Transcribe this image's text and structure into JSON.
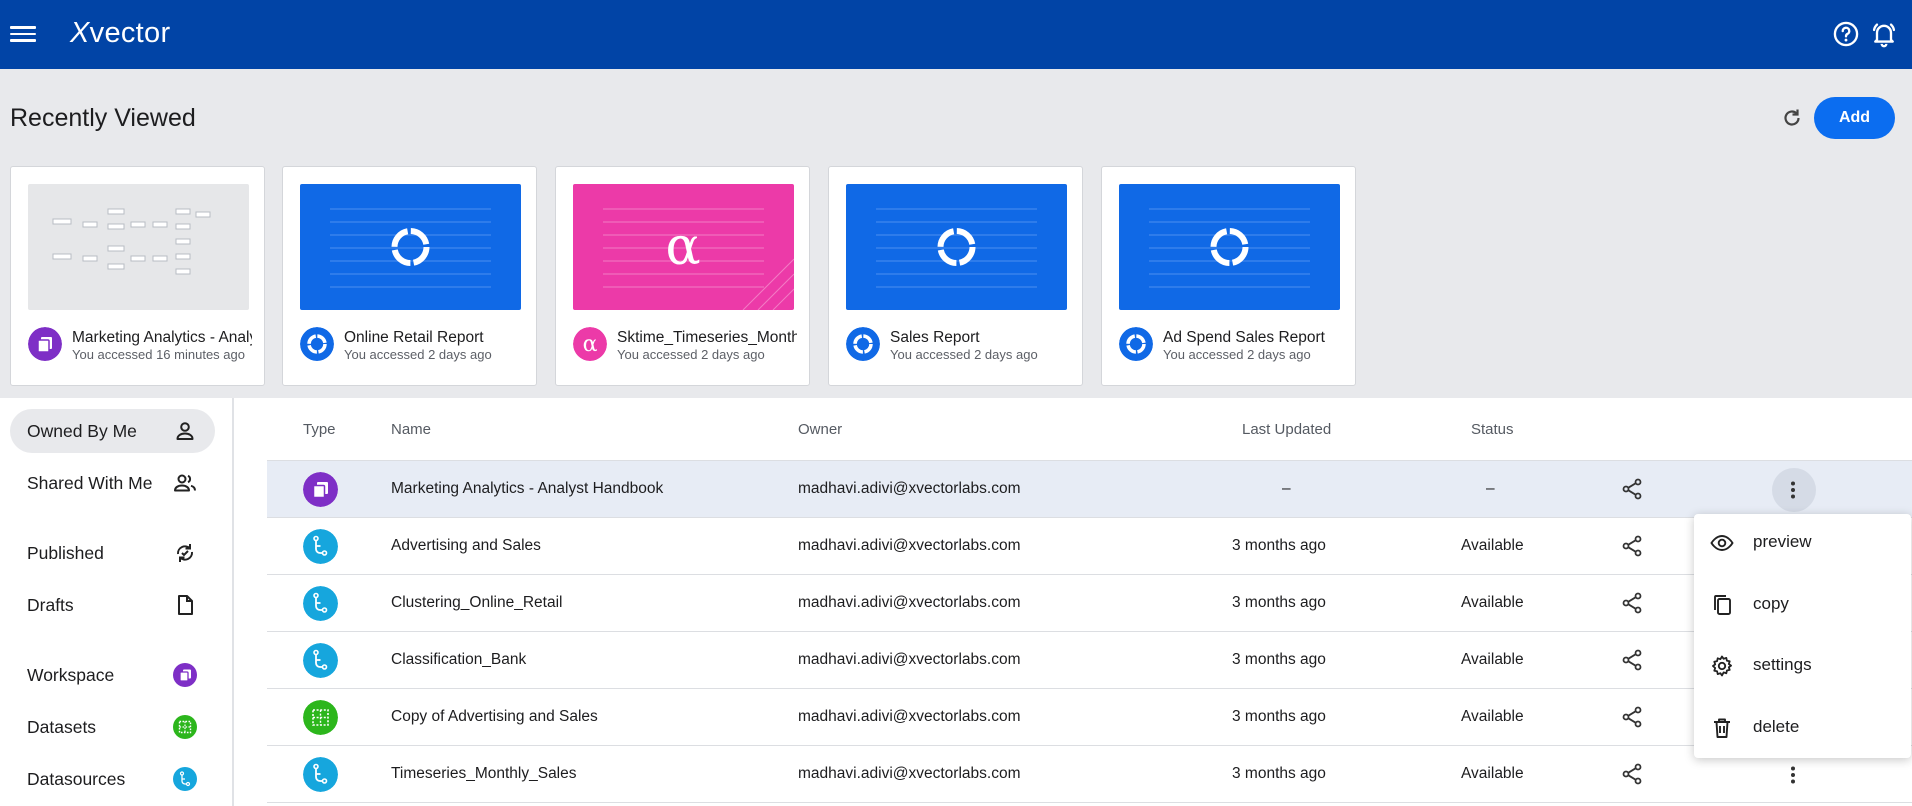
{
  "app": {
    "brand_prefix": "X",
    "brand_rest": "vector"
  },
  "colors": {
    "topbar": "#0144a6",
    "accent": "#0b6df0",
    "workspace": "#7e2fc6",
    "dataset": "#2cb61c",
    "datasource": "#16a6dd",
    "pink": "#ec3aa8"
  },
  "recently_viewed": {
    "title": "Recently Viewed",
    "add_label": "Add",
    "cards": [
      {
        "title": "Marketing Analytics - Analyst Handbook",
        "sub": "You accessed 16 minutes ago",
        "icon": "workspace-icon"
      },
      {
        "title": "Online Retail Report",
        "sub": "You accessed 2 days ago",
        "icon": "report-icon"
      },
      {
        "title": "Sktime_Timeseries_Monthly",
        "sub": "You accessed 2 days ago",
        "icon": "alpha-icon"
      },
      {
        "title": "Sales Report",
        "sub": "You accessed 2 days ago",
        "icon": "report-icon"
      },
      {
        "title": "Ad Spend Sales Report",
        "sub": "You accessed 2 days ago",
        "icon": "report-icon"
      }
    ]
  },
  "sidebar": {
    "items": [
      {
        "label": "Owned By Me",
        "icon": "person-icon"
      },
      {
        "label": "Shared With Me",
        "icon": "people-icon"
      },
      {
        "label": "Published",
        "icon": "sync-icon"
      },
      {
        "label": "Drafts",
        "icon": "file-icon"
      },
      {
        "label": "Workspace",
        "icon": "workspace-icon"
      },
      {
        "label": "Datasets",
        "icon": "dataset-icon"
      },
      {
        "label": "Datasources",
        "icon": "datasource-icon"
      }
    ]
  },
  "table": {
    "headers": {
      "type": "Type",
      "name": "Name",
      "owner": "Owner",
      "updated": "Last Updated",
      "status": "Status"
    },
    "rows": [
      {
        "type": "workspace",
        "name": "Marketing Analytics - Analyst Handbook",
        "owner": "madhavi.adivi@xvectorlabs.com",
        "updated": "–",
        "status": "–"
      },
      {
        "type": "datasource",
        "name": "Advertising and Sales",
        "owner": "madhavi.adivi@xvectorlabs.com",
        "updated": "3 months ago",
        "status": "Available"
      },
      {
        "type": "datasource",
        "name": "Clustering_Online_Retail",
        "owner": "madhavi.adivi@xvectorlabs.com",
        "updated": "3 months ago",
        "status": "Available"
      },
      {
        "type": "datasource",
        "name": "Classification_Bank",
        "owner": "madhavi.adivi@xvectorlabs.com",
        "updated": "3 months ago",
        "status": "Available"
      },
      {
        "type": "dataset",
        "name": "Copy of Advertising and Sales",
        "owner": "madhavi.adivi@xvectorlabs.com",
        "updated": "3 months ago",
        "status": "Available"
      },
      {
        "type": "datasource",
        "name": "Timeseries_Monthly_Sales",
        "owner": "madhavi.adivi@xvectorlabs.com",
        "updated": "3 months ago",
        "status": "Available"
      }
    ]
  },
  "context_menu": {
    "items": [
      {
        "label": "preview",
        "icon": "eye-icon"
      },
      {
        "label": "copy",
        "icon": "copy-icon"
      },
      {
        "label": "settings",
        "icon": "gear-icon"
      },
      {
        "label": "delete",
        "icon": "trash-icon"
      }
    ]
  }
}
